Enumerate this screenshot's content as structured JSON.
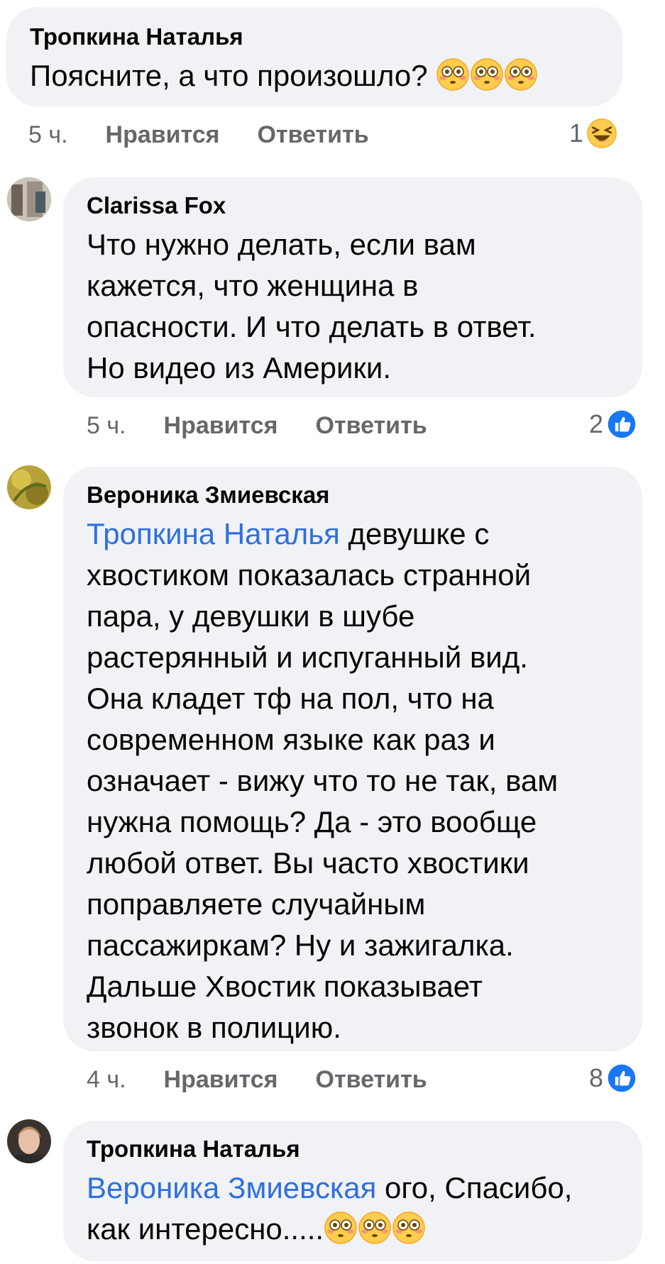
{
  "comments": [
    {
      "author": "Тропкина Наталья",
      "text": "Поясните, а что произошло?",
      "emojis": [
        "flushed-face",
        "flushed-face",
        "flushed-face"
      ],
      "time": "5 ч.",
      "like_label": "Нравится",
      "reply_label": "Ответить",
      "reaction_count": "1",
      "reaction_icon": "laughing-face"
    },
    {
      "author": "Clarissa Fox",
      "lines": [
        "Что нужно делать, если вам",
        "кажется, что женщина в",
        "опасности. И что делать в ответ.",
        "Но видео из Америки."
      ],
      "time": "5 ч.",
      "like_label": "Нравится",
      "reply_label": "Ответить",
      "reaction_count": "2",
      "reaction_icon": "thumbs-up"
    },
    {
      "author": "Вероника Змиевская",
      "mention": "Тропкина Наталья",
      "first_line_rest": " девушке с",
      "lines": [
        "хвостиком показалась странной",
        "пара, у девушки в шубе",
        "растерянный и испуганный вид.",
        "Она кладет тф на пол, что на",
        "современном языке как раз и",
        "означает - вижу что то не так, вам",
        "нужна помощь? Да - это вообще",
        "любой ответ. Вы часто хвостики",
        "поправляете случайным",
        "пассажиркам? Ну и зажигалка.",
        "Дальше Хвостик показывает",
        "звонок в полицию."
      ],
      "time": "4 ч.",
      "like_label": "Нравится",
      "reply_label": "Ответить",
      "reaction_count": "8",
      "reaction_icon": "thumbs-up"
    },
    {
      "author": "Тропкина Наталья",
      "mention": "Вероника Змиевская",
      "first_line_rest": " ого, Спасибо,",
      "second_line": "как интересно.....",
      "emojis": [
        "flushed-face",
        "flushed-face",
        "flushed-face"
      ]
    }
  ],
  "colors": {
    "bubble": "#f0f2f5",
    "mention": "#2f6fde",
    "meta": "#65676b",
    "like_blue": "#1877f2"
  }
}
